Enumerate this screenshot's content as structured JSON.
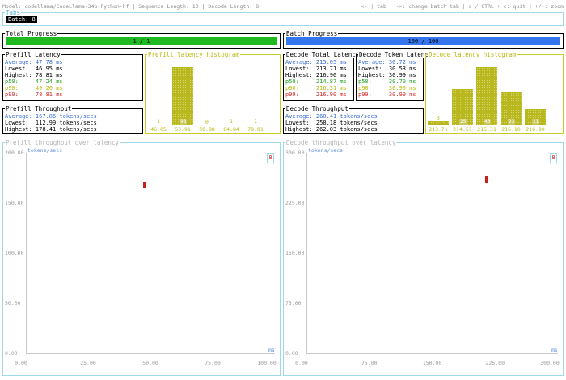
{
  "header": {
    "info": "Model: codellama/CodeLlama-34b-Python-hf | Sequence Length: 10 | Decode Length: 8",
    "help": "<- | tab | ->: change batch tab | q / CTRL + c: quit | +/-: zoom"
  },
  "tabs": {
    "label": "Tabs",
    "batch": "Batch: 8"
  },
  "total_progress": {
    "title": "Total Progress",
    "text": "1 / 1",
    "fraction": 1.0,
    "color": "#1fba1f"
  },
  "batch_progress": {
    "title": "Batch Progress",
    "text": "100 / 100",
    "fraction": 1.0,
    "color": "#3576ee"
  },
  "prefill_latency": {
    "title": "Prefill Latency",
    "average": "Average: 47.78 ms",
    "lowest": "Lowest:  46.95 ms",
    "highest": "Highest: 78.81 ms",
    "p50": "p50:     47.24 ms",
    "p90": "p90:     49.20 ms",
    "p99": "p99:     78.81 ms"
  },
  "prefill_histogram": {
    "title": "Prefill latency histogram",
    "bars": [
      {
        "label": "46.05",
        "count": 1
      },
      {
        "label": "53.91",
        "count": 98
      },
      {
        "label": "58.88",
        "count": 0
      },
      {
        "label": "64.84",
        "count": 1
      },
      {
        "label": "78.81",
        "count": 1
      }
    ]
  },
  "prefill_throughput": {
    "title": "Prefill Throughput",
    "average": "Average: 167.86 tokens/secs",
    "lowest": "Lowest:  112.99 tokens/secs",
    "highest": "Highest: 178.41 tokens/secs"
  },
  "decode_total_latency": {
    "title": "Decode Total Latency",
    "average": "Average: 215.05 ms",
    "lowest": "Lowest:  213.71 ms",
    "highest": "Highest: 216.90 ms",
    "p50": "p50:     214.87 ms",
    "p90": "p90:     216.31 ms",
    "p99": "p99:     216.90 ms"
  },
  "decode_token_latency": {
    "title": "Decode Token Latency",
    "average": "Average: 30.72 ms",
    "lowest": "Lowest:  30.53 ms",
    "highest": "Highest: 30.99 ms",
    "p50": "p50:     30.70 ms",
    "p90": "p90:     30.90 ms",
    "p99": "p99:     30.99 ms"
  },
  "decode_histogram": {
    "title": "Decode latency histogram",
    "bars": [
      {
        "label": "213.71",
        "count": 3
      },
      {
        "label": "214.51",
        "count": 25
      },
      {
        "label": "215.31",
        "count": 40
      },
      {
        "label": "216.10",
        "count": 23
      },
      {
        "label": "216.90",
        "count": 11
      }
    ]
  },
  "decode_throughput": {
    "title": "Decode Throughput",
    "average": "Average: 260.41 tokens/secs",
    "lowest": "Lowest:  258.18 tokens/secs",
    "highest": "Highest: 262.03 tokens/secs"
  },
  "prefill_scatter": {
    "title": "Prefill throughput over latency",
    "ylabel": "tokens/secs",
    "xlabel": "ms",
    "legend": "8",
    "yticks": [
      "200.00",
      "150.00",
      "100.00",
      "50.00",
      "0.00"
    ],
    "xticks": [
      "0.00",
      "25.00",
      "50.00",
      "75.00",
      "100.00"
    ],
    "point": {
      "x": 47.8,
      "y": 167.9
    },
    "xlim": [
      0,
      100
    ],
    "ylim": [
      0,
      200
    ]
  },
  "decode_scatter": {
    "title": "Decode throughput over latency",
    "ylabel": "tokens/secs",
    "xlabel": "ms",
    "legend": "8",
    "yticks": [
      "300.00",
      "225.00",
      "150.00",
      "75.00",
      "0.00"
    ],
    "xticks": [
      "0.00",
      "75.00",
      "150.00",
      "225.00",
      "300.00"
    ],
    "point": {
      "x": 215.1,
      "y": 260.4
    },
    "xlim": [
      0,
      300
    ],
    "ylim": [
      0,
      300
    ]
  },
  "colors": {
    "accent_red": "#c81e1e",
    "histogram": "#b9b81f",
    "grid_border": "#9fd8e8"
  }
}
